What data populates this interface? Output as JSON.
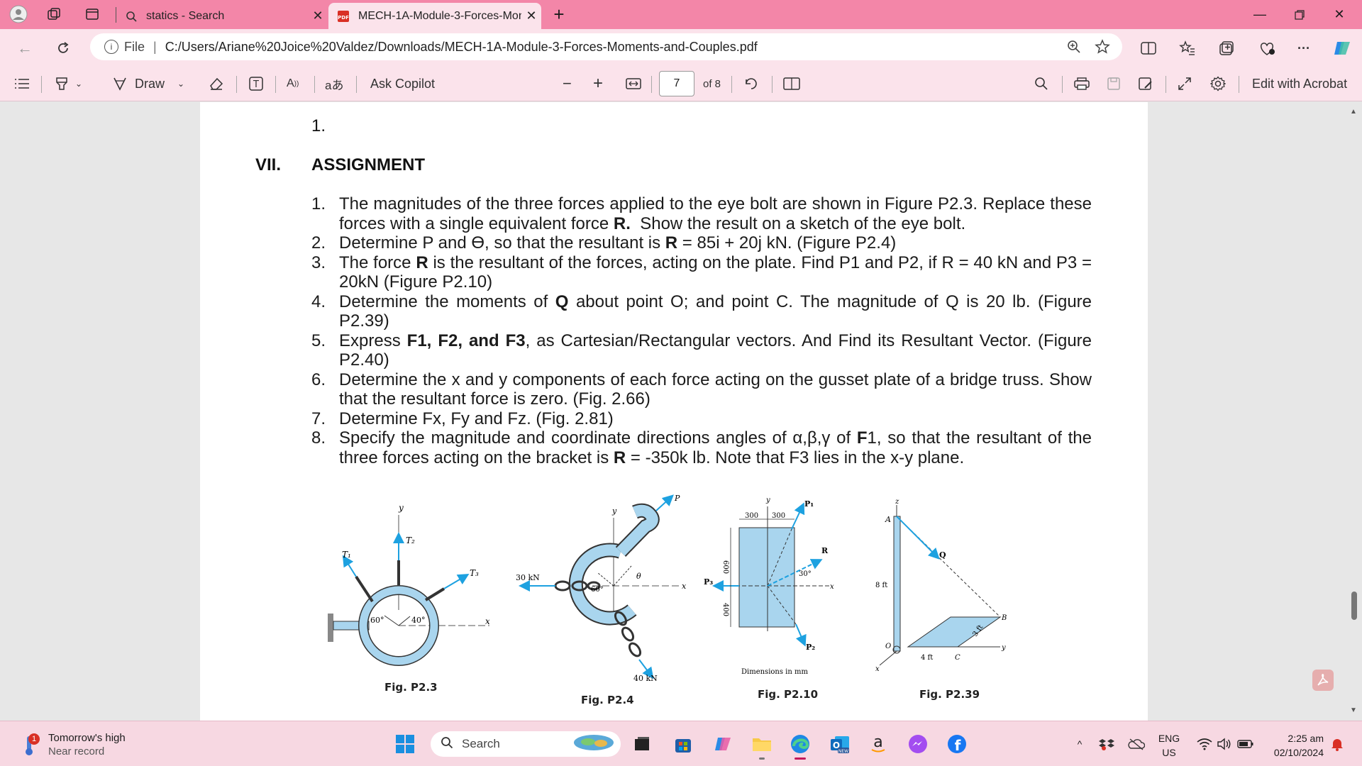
{
  "browser": {
    "tabs": [
      {
        "title": "statics - Search",
        "active": false
      },
      {
        "title": "MECH-1A-Module-3-Forces-Mon",
        "active": true
      }
    ],
    "address": {
      "file_label": "File",
      "url": "C:/Users/Ariane%20Joice%20Valdez/Downloads/MECH-1A-Module-3-Forces-Moments-and-Couples.pdf"
    }
  },
  "pdf_toolbar": {
    "draw_label": "Draw",
    "ask_copilot": "Ask Copilot",
    "current_page": "7",
    "total_pages": "of 8",
    "edit_with_acrobat": "Edit with Acrobat"
  },
  "document": {
    "first_item": "1.",
    "section_roman": "VII.",
    "section_title": "ASSIGNMENT",
    "items": [
      {
        "num": "1.",
        "html": "The magnitudes of the three forces applied to the eye bolt are shown in Figure P2.3. Replace these forces with a single equivalent force <b>R.</b>&nbsp; Show the result on a sketch of the eye bolt."
      },
      {
        "num": "2.",
        "html": "Determine P and Ɵ, so that the resultant is <b>R</b> = 85i + 20j kN. (Figure P2.4)"
      },
      {
        "num": "3.",
        "html": "The force <b>R</b> is the resultant of the forces, acting on the plate. Find P1 and P2, if R = 40 kN and P3 = 20kN (Figure P2.10)"
      },
      {
        "num": "4.",
        "html": "Determine the moments of <b>Q</b> about point O; and point C. The magnitude of Q is 20 lb. (Figure P2.39)"
      },
      {
        "num": "5.",
        "html": "Express <b>F1, F2, and F3</b>, as Cartesian/Rectangular vectors. And Find its Resultant Vector. (Figure P2.40)"
      },
      {
        "num": "6.",
        "html": "Determine the x and y components of each force acting on the gusset plate of a bridge truss. Show that the resultant force is zero. (Fig. 2.66)"
      },
      {
        "num": "7.",
        "html": "Determine Fx, Fy and Fz. (Fig. 2.81)"
      },
      {
        "num": "8.",
        "html": "Specify the magnitude and coordinate directions angles of α,β,γ of <b>F</b>1, so that the resultant of the three forces acting on the bracket is <b>R</b> = -350k lb. Note that F3 lies in the x-y plane."
      }
    ],
    "figures": {
      "p23": {
        "caption": "Fig. P2.3",
        "t1": "T₁",
        "t2": "T₂",
        "t3": "T₃",
        "y": "y",
        "x": "x",
        "a1": "60°",
        "a2": "40°"
      },
      "p24": {
        "caption": "Fig. P2.4",
        "f30": "30 kN",
        "f40": "40 kN",
        "p": "P",
        "theta": "θ",
        "a60": "60°",
        "y": "y",
        "x": "x"
      },
      "p210": {
        "caption": "Fig. P2.10",
        "d300a": "300",
        "d300b": "300",
        "d600": "600",
        "d400": "400",
        "r": "R",
        "p1": "P₁",
        "p2": "P₂",
        "p3": "P₃",
        "a30": "30°",
        "units": "Dimensions in mm",
        "y": "y",
        "x": "x"
      },
      "p239": {
        "caption": "Fig. P2.39",
        "q": "Q",
        "a": "A",
        "b": "B",
        "c": "C",
        "o": "O",
        "h8": "8 ft",
        "w4": "4 ft",
        "d3": "3 ft",
        "x": "x",
        "y": "y",
        "z": "z"
      }
    }
  },
  "taskbar": {
    "weather_line1": "Tomorrow's high",
    "weather_line2": "Near record",
    "weather_badge": "1",
    "search_label": "Search",
    "lang_line1": "ENG",
    "lang_line2": "US",
    "time": "2:25 am",
    "date": "02/10/2024"
  },
  "colors": {
    "titlebar": "#f386a8",
    "toolbar": "#fbe3eb",
    "taskbar": "#f7d8e2",
    "figure_blue": "#a9d5ee",
    "arrow_blue": "#1da1e0"
  }
}
